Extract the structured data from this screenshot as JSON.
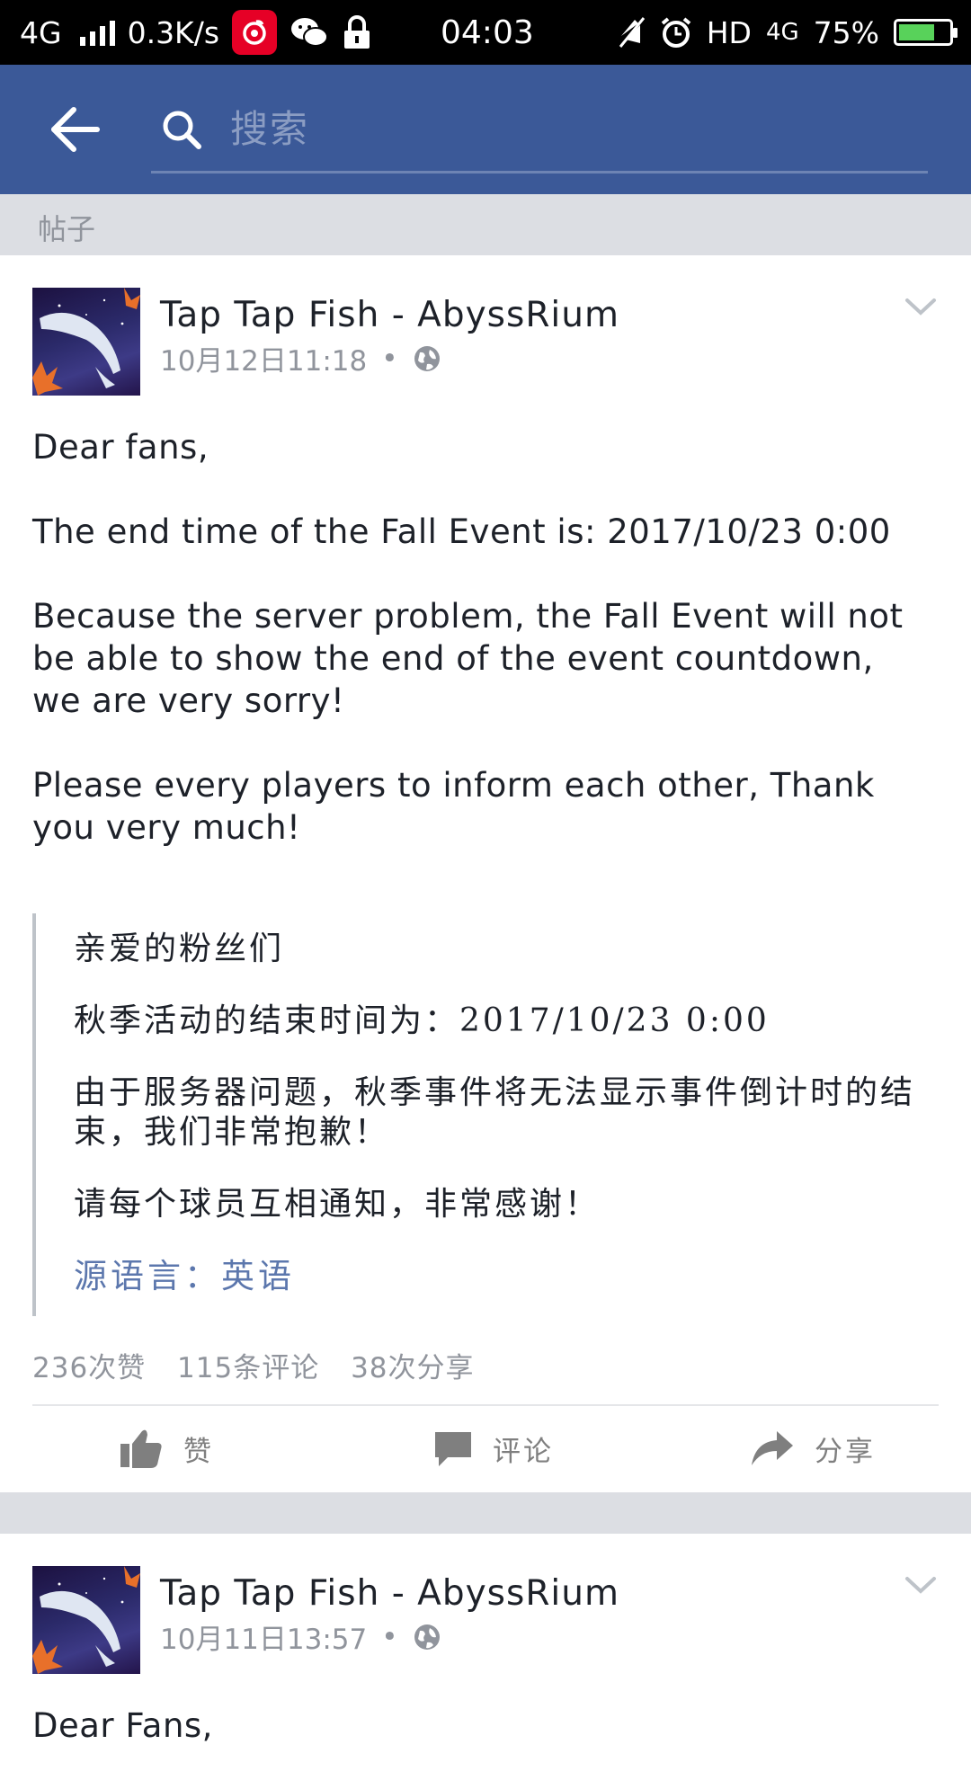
{
  "status_bar": {
    "network": "4G",
    "speed": "0.3K/s",
    "time": "04:03",
    "hd": "HD",
    "network_right": "4G",
    "battery": "75%",
    "battery_level": 0.75,
    "icons": [
      "signal-icon",
      "netease-music-icon",
      "wechat-icon",
      "lock-icon",
      "mute-icon",
      "alarm-icon",
      "battery-icon"
    ]
  },
  "header": {
    "search_placeholder": "搜索",
    "color": "#3b5998"
  },
  "section_label": "帖子",
  "posts": [
    {
      "author": "Tap Tap Fish - AbyssRium",
      "timestamp": "10月12日11:18",
      "dot": "•",
      "body": [
        "Dear fans,",
        "The end time of the Fall Event is: 2017/10/23 0:00",
        "Because the server problem, the Fall Event will not be able to show the end of the event countdown, we are very sorry!",
        "Please every players to inform each other, Thank you very much!"
      ],
      "translation": [
        "亲爱的粉丝们",
        "秋季活动的结束时间为：2017/10/23 0:00",
        "由于服务器问题，秋季事件将无法显示事件倒计时的结束，我们非常抱歉！",
        "请每个球员互相通知，非常感谢！"
      ],
      "source_language": "源语言：英语",
      "likes": "236次赞",
      "comments": "115条评论",
      "shares": "38次分享",
      "actions": {
        "like": "赞",
        "comment": "评论",
        "share": "分享"
      }
    },
    {
      "author": "Tap Tap Fish - AbyssRium",
      "timestamp": "10月11日13:57",
      "dot": "•",
      "body": [
        "Dear Fans,"
      ]
    }
  ]
}
